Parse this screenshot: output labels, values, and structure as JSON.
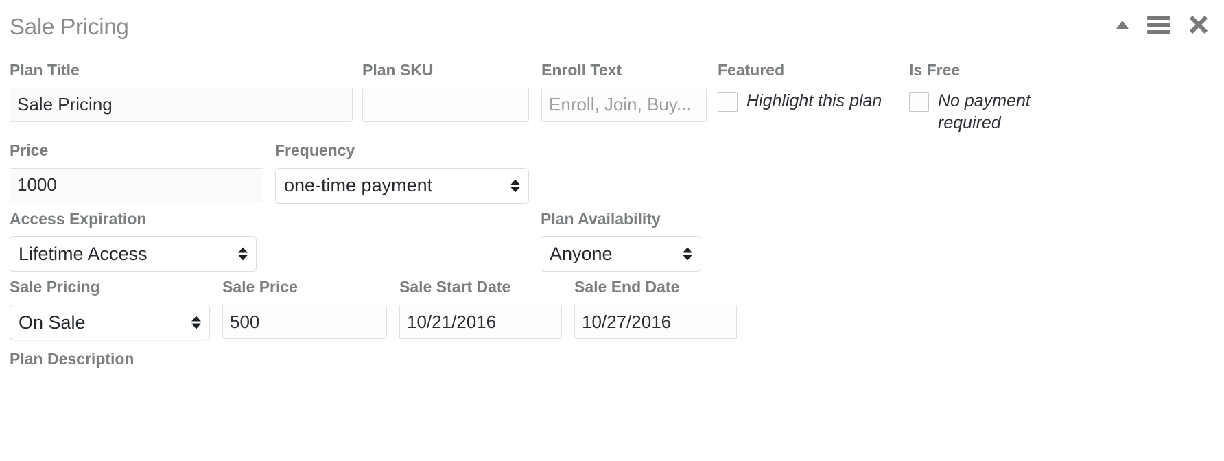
{
  "header": {
    "title": "Sale Pricing",
    "icons": {
      "collapse": "collapse-triangle-icon",
      "menu": "hamburger-handle-icon",
      "close": "close-icon"
    }
  },
  "fields": {
    "plan_title": {
      "label": "Plan Title",
      "value": "Sale Pricing",
      "placeholder": ""
    },
    "plan_sku": {
      "label": "Plan SKU",
      "value": "",
      "placeholder": ""
    },
    "enroll_text": {
      "label": "Enroll Text",
      "value": "",
      "placeholder": "Enroll, Join, Buy..."
    },
    "featured": {
      "label": "Featured",
      "description": "Highlight this plan",
      "checked": false
    },
    "is_free": {
      "label": "Is Free",
      "description": "No payment required",
      "checked": false
    },
    "price": {
      "label": "Price",
      "value": "1000",
      "placeholder": ""
    },
    "frequency": {
      "label": "Frequency",
      "value": "one-time payment"
    },
    "access_expiration": {
      "label": "Access Expiration",
      "value": "Lifetime Access"
    },
    "plan_availability": {
      "label": "Plan Availability",
      "value": "Anyone"
    },
    "sale_pricing": {
      "label": "Sale Pricing",
      "value": "On Sale"
    },
    "sale_price": {
      "label": "Sale Price",
      "value": "500",
      "placeholder": ""
    },
    "sale_start_date": {
      "label": "Sale Start Date",
      "value": "10/21/2016",
      "placeholder": ""
    },
    "sale_end_date": {
      "label": "Sale End Date",
      "value": "10/27/2016",
      "placeholder": ""
    },
    "plan_description": {
      "label": "Plan Description"
    }
  },
  "colors": {
    "label": "#7b7f81",
    "title": "#888c8e",
    "value": "#25292d",
    "border": "#dcdee0",
    "icon": "#77797a"
  }
}
